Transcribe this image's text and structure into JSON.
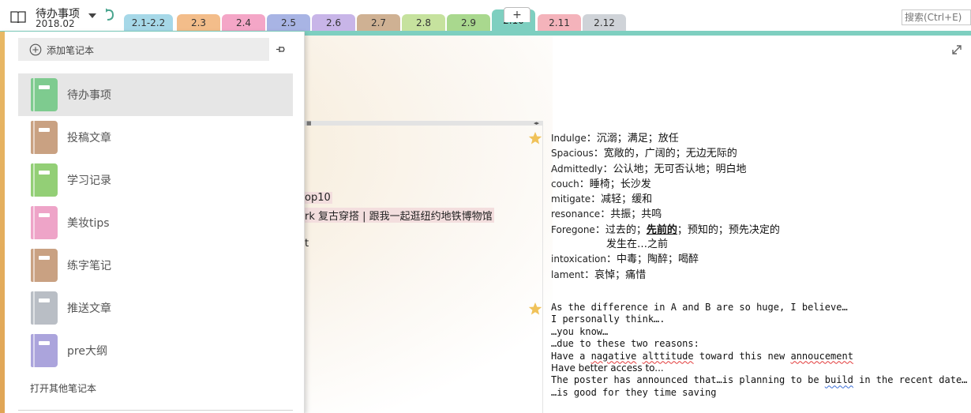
{
  "notebook": {
    "title": "待办事项",
    "section": "2018.02"
  },
  "tabs": [
    {
      "label": "2.1-2.2",
      "color": "#a6d8e8"
    },
    {
      "label": "2.3",
      "color": "#f3bd8a"
    },
    {
      "label": "2.4",
      "color": "#f4a6c7"
    },
    {
      "label": "2.5",
      "color": "#a8b4e4"
    },
    {
      "label": "2.6",
      "color": "#c8b5e8"
    },
    {
      "label": "2.7",
      "color": "#cfb193"
    },
    {
      "label": "2.8",
      "color": "#c6e29e"
    },
    {
      "label": "2.9",
      "color": "#a9d88e"
    },
    {
      "label": "2.10",
      "color": "#7ecfc0",
      "active": true
    },
    {
      "label": "2.11",
      "color": "#f4b3bb"
    },
    {
      "label": "2.12",
      "color": "#cfd3d8"
    }
  ],
  "tab_add_label": "+",
  "search": {
    "placeholder": "搜索(Ctrl+E)"
  },
  "panel": {
    "add_label": "添加笔记本",
    "open_other_label": "打开其他笔记本",
    "notebooks": [
      {
        "name": "待办事项",
        "color": "#7ecb8f",
        "selected": true
      },
      {
        "name": "投稿文章",
        "color": "#c9a182"
      },
      {
        "name": "学习记录",
        "color": "#93cf76"
      },
      {
        "name": "美妆tips",
        "color": "#eea4c8"
      },
      {
        "name": "练字笔记",
        "color": "#c9a182"
      },
      {
        "name": "推送文章",
        "color": "#b9bec5"
      },
      {
        "name": "pre大纲",
        "color": "#aba4dc"
      }
    ]
  },
  "page": {
    "fragments": [
      "op10",
      "rk 复古穿搭 | 跟我一起逛纽约地铁博物馆",
      "t"
    ],
    "vocab": [
      {
        "word": "Indulge",
        "meaning": "沉溺；满足；放任"
      },
      {
        "word": "Spacious",
        "meaning": "宽敞的，广阔的；无边无际的"
      },
      {
        "word": "Admittedly",
        "meaning": "公认地；无可否认地；明白地"
      },
      {
        "word": "couch",
        "meaning": "睡椅；长沙发"
      },
      {
        "word": "mitigate",
        "meaning": "减轻；缓和"
      },
      {
        "word": "resonance",
        "meaning": "共振；共鸣"
      },
      {
        "word": "Foregone",
        "meaning_before": "过去的；",
        "meaning_emph": "先前的",
        "meaning_after": "；预知的；预先决定的",
        "continuation": "发生在…之前"
      },
      {
        "word": "intoxication",
        "meaning": "中毒；陶醉；喝醉"
      },
      {
        "word": "lament",
        "meaning": "哀悼；痛惜"
      }
    ],
    "speaking": {
      "line1": "As the difference in A and B are so huge, I believe…",
      "line2": "I personally think….",
      "line3": "…you know…",
      "line4": "…due to these two reasons:",
      "line5_a": "Have a ",
      "line5_err1": "nagative",
      "line5_b": " ",
      "line5_err2": "alttitude",
      "line5_c": " toward this new ",
      "line5_err3": "annoucement",
      "line6": "Have better access to...",
      "line7_a": "The poster has announced that…is planning to be ",
      "line7_err": "build",
      "line7_b": " in the recent date…",
      "line8": "…is good for they time saving"
    }
  }
}
